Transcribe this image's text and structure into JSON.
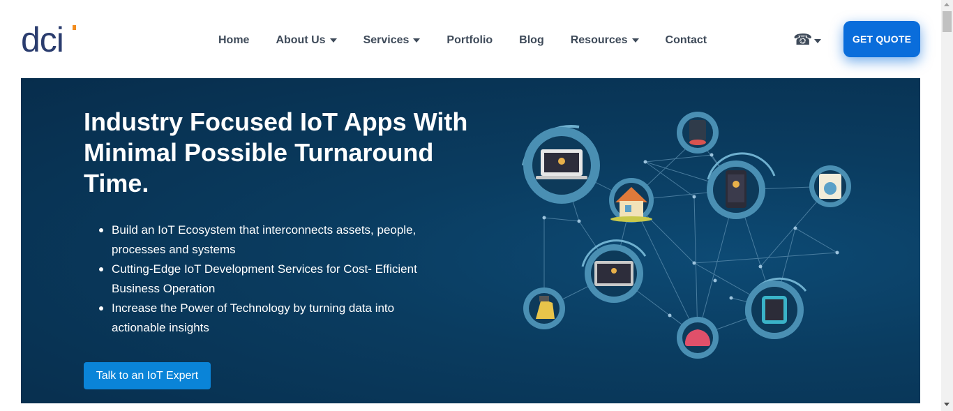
{
  "header": {
    "logo_text": "dci",
    "nav": [
      {
        "label": "Home",
        "has_dropdown": false
      },
      {
        "label": "About Us",
        "has_dropdown": true
      },
      {
        "label": "Services",
        "has_dropdown": true
      },
      {
        "label": "Portfolio",
        "has_dropdown": false
      },
      {
        "label": "Blog",
        "has_dropdown": false
      },
      {
        "label": "Resources",
        "has_dropdown": true
      },
      {
        "label": "Contact",
        "has_dropdown": false
      }
    ],
    "phone_icon": "☎",
    "quote_button": "GET QUOTE"
  },
  "hero": {
    "title": "Industry Focused IoT Apps With Minimal Possible Turnaround Time.",
    "bullets": [
      "Build an IoT Ecosystem that interconnects assets, people, processes and systems",
      "Cutting-Edge IoT Development Services for Cost- Efficient Business Operation",
      "Increase the Power of Technology by turning data into actionable insights"
    ],
    "cta": "Talk to an IoT Expert"
  },
  "colors": {
    "brand_navy": "#2a3c6e",
    "brand_orange": "#f28c1e",
    "accent_blue": "#0a6ddb",
    "hero_bg": "#072d4c"
  }
}
